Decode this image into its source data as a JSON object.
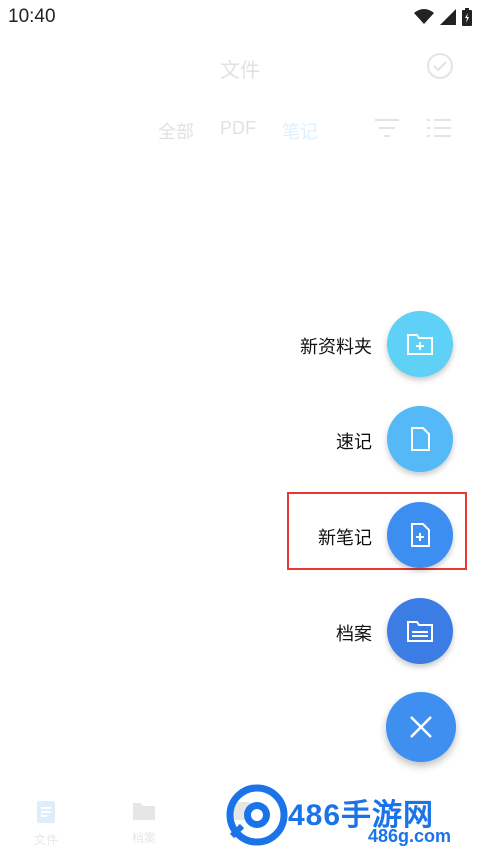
{
  "status_bar": {
    "time": "10:40"
  },
  "header": {
    "title": "文件"
  },
  "filter_tabs": [
    "全部",
    "PDF",
    "笔记"
  ],
  "bottom_nav": [
    {
      "label": "文件",
      "icon": "document-icon"
    },
    {
      "label": "档案",
      "icon": "folder-icon"
    },
    {
      "label": "",
      "icon": ""
    },
    {
      "label": "",
      "icon": ""
    }
  ],
  "speed_dial": {
    "new_folder_label": "新资料夹",
    "quick_note_label": "速记",
    "new_note_label": "新笔记",
    "archive_label": "档案"
  },
  "colors": {
    "fab_new_folder": "#5fd0f6",
    "fab_quick_note": "#54b9f6",
    "fab_new_note": "#3c8ff1",
    "fab_archive": "#3b7de4",
    "fab_main": "#3f8ff0",
    "highlight": "#e53935",
    "active_tab": "#2196f3"
  },
  "watermark": {
    "title": "486手游网",
    "url": "486g.com"
  }
}
